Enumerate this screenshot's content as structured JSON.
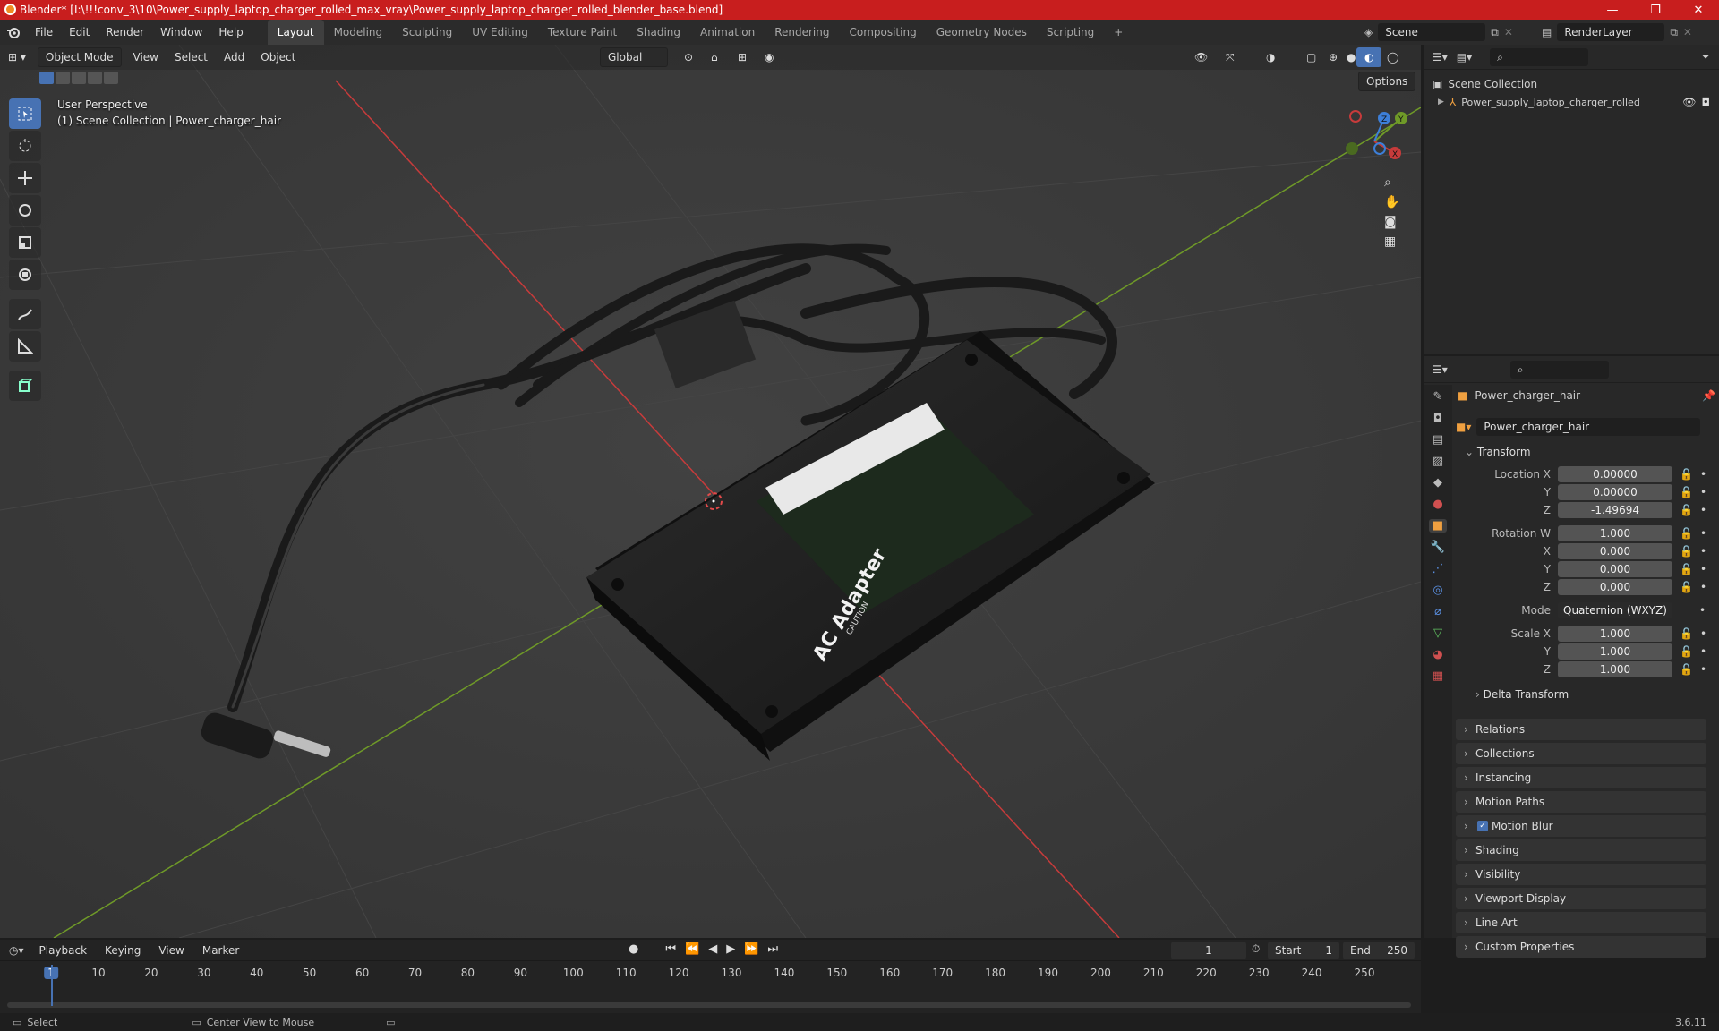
{
  "window": {
    "title": "Blender* [I:\\!!!conv_3\\10\\Power_supply_laptop_charger_rolled_max_vray\\Power_supply_laptop_charger_rolled_blender_base.blend]",
    "minimize": "—",
    "maximize": "❐",
    "close": "✕"
  },
  "menubar": {
    "items": [
      "File",
      "Edit",
      "Render",
      "Window",
      "Help"
    ],
    "workspaces": [
      "Layout",
      "Modeling",
      "Sculpting",
      "UV Editing",
      "Texture Paint",
      "Shading",
      "Animation",
      "Rendering",
      "Compositing",
      "Geometry Nodes",
      "Scripting"
    ],
    "add_workspace": "+",
    "scene_label": "Scene",
    "renderlayer_label": "RenderLayer"
  },
  "viewport": {
    "mode": "Object Mode",
    "menus": [
      "View",
      "Select",
      "Add",
      "Object"
    ],
    "transform_orientation": "Global",
    "options": "Options",
    "overlay_line1": "User Perspective",
    "overlay_line2": "(1) Scene Collection | Power_charger_hair",
    "label_title": "AC Adapter",
    "label_caution": "CAUTION"
  },
  "gizmo": {
    "x": "X",
    "y": "Y",
    "z": "Z"
  },
  "outliner": {
    "root": "Scene Collection",
    "item": "Power_supply_laptop_charger_rolled"
  },
  "properties": {
    "object_name": "Power_charger_hair",
    "data_name": "Power_charger_hair",
    "transform_header": "Transform",
    "location_x_label": "Location X",
    "location_x": "0.00000",
    "location_y_label": "Y",
    "location_y": "0.00000",
    "location_z_label": "Z",
    "location_z": "-1.49694",
    "rotation_w_label": "Rotation W",
    "rotation_w": "1.000",
    "rotation_x_label": "X",
    "rotation_x": "0.000",
    "rotation_y_label": "Y",
    "rotation_y": "0.000",
    "rotation_z_label": "Z",
    "rotation_z": "0.000",
    "mode_label": "Mode",
    "mode_value": "Quaternion (WXYZ)",
    "scale_x_label": "Scale X",
    "scale_x": "1.000",
    "scale_y_label": "Y",
    "scale_y": "1.000",
    "scale_z_label": "Z",
    "scale_z": "1.000",
    "delta_transform": "Delta Transform",
    "sections": [
      "Relations",
      "Collections",
      "Instancing",
      "Motion Paths",
      "Motion Blur",
      "Shading",
      "Visibility",
      "Viewport Display",
      "Line Art",
      "Custom Properties"
    ]
  },
  "timeline": {
    "menus": [
      "Playback",
      "Keying",
      "View",
      "Marker"
    ],
    "current_frame": "1",
    "start_label": "Start",
    "start": "1",
    "end_label": "End",
    "end": "250",
    "ticks": [
      "1",
      "10",
      "20",
      "30",
      "40",
      "50",
      "60",
      "70",
      "80",
      "90",
      "100",
      "110",
      "120",
      "130",
      "140",
      "150",
      "160",
      "170",
      "180",
      "190",
      "200",
      "210",
      "220",
      "230",
      "240",
      "250"
    ]
  },
  "statusbar": {
    "select": "Select",
    "center_view": "Center View to Mouse",
    "version": "3.6.11"
  },
  "colors": {
    "titlebar": "#c81e1e",
    "accent": "#4772b3",
    "x_axis": "#c73b3b",
    "y_axis": "#6f9a28",
    "z_axis": "#3d7fd8"
  }
}
